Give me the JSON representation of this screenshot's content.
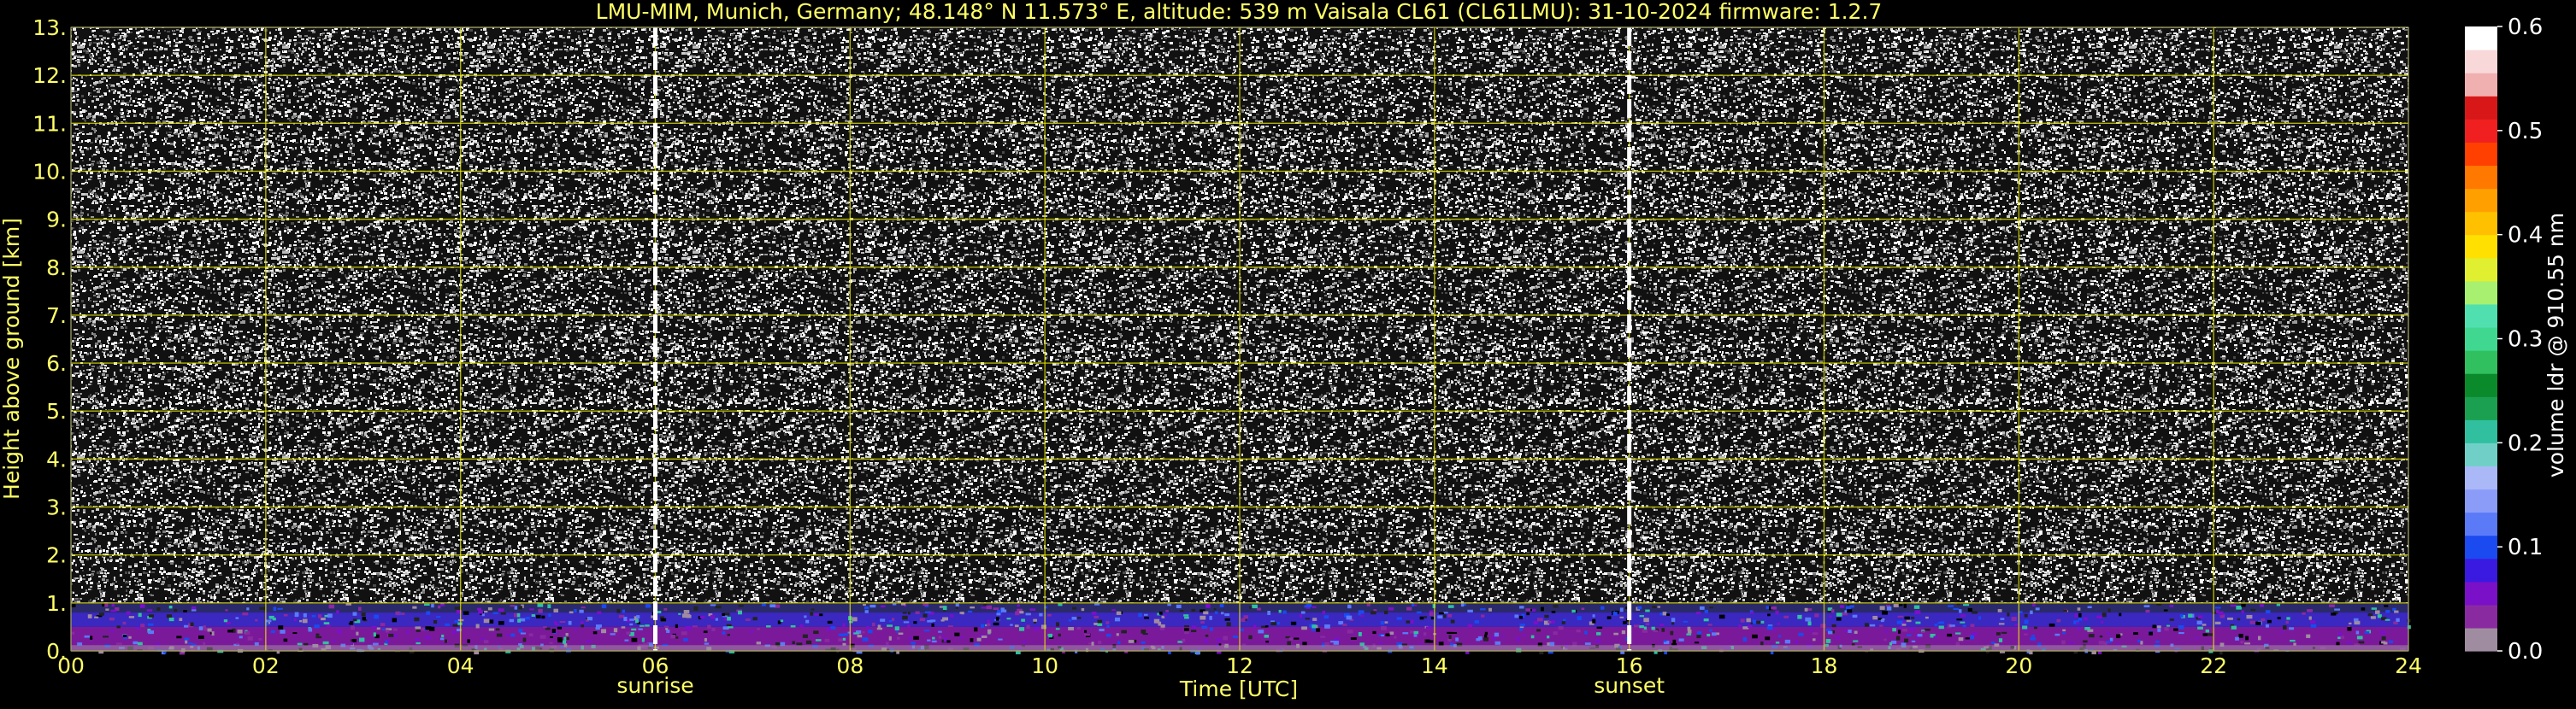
{
  "chart_data": {
    "type": "heatmap",
    "title": "LMU-MIM, Munich, Germany; 48.148° N 11.573° E, altitude: 539 m    Vaisala CL61 (CL61LMU): 31-10-2024    firmware: 1.2.7",
    "xlabel": "Time [UTC]",
    "ylabel": "Height above ground [km]",
    "xlim": [
      0,
      24
    ],
    "ylim": [
      0,
      13
    ],
    "x_ticks": [
      "00",
      "02",
      "04",
      "06",
      "08",
      "10",
      "12",
      "14",
      "16",
      "18",
      "20",
      "22",
      "24"
    ],
    "x_tick_values": [
      0,
      2,
      4,
      6,
      8,
      10,
      12,
      14,
      16,
      18,
      20,
      22,
      24
    ],
    "y_ticks": [
      "0.",
      "1.",
      "2.",
      "3.",
      "4.",
      "5.",
      "6.",
      "7.",
      "8.",
      "9.",
      "10.",
      "11.",
      "12.",
      "13."
    ],
    "y_tick_values": [
      0,
      1,
      2,
      3,
      4,
      5,
      6,
      7,
      8,
      9,
      10,
      11,
      12,
      13
    ],
    "grid": true,
    "markers": [
      {
        "label": "sunrise",
        "x": 6.0
      },
      {
        "label": "sunset",
        "x": 16.0
      }
    ],
    "colorbar": {
      "label": "volume ldr @ 910.55 nm",
      "range": [
        0.0,
        0.6
      ],
      "ticks": [
        "0.0",
        "0.1",
        "0.2",
        "0.3",
        "0.4",
        "0.5",
        "0.6"
      ],
      "tick_values": [
        0.0,
        0.1,
        0.2,
        0.3,
        0.4,
        0.5,
        0.6
      ],
      "colors": [
        "#a08ca0",
        "#8a2aa0",
        "#7a10c8",
        "#3a1ae0",
        "#1a4af0",
        "#5a7af8",
        "#8a9cf8",
        "#aab8f8",
        "#70d0c8",
        "#30c0a0",
        "#1aa050",
        "#0a8a2a",
        "#30c060",
        "#40d890",
        "#50e0b0",
        "#a8f070",
        "#e0f030",
        "#ffe000",
        "#ffc000",
        "#ffa000",
        "#ff7800",
        "#ff4000",
        "#f02020",
        "#d81818",
        "#f0b0b0",
        "#f8d8d8",
        "#ffffff"
      ]
    },
    "colors": {
      "text": "#ffff66",
      "grid": "#e6e600",
      "background": "#000000",
      "colorbar_text": "#ffffff"
    }
  }
}
